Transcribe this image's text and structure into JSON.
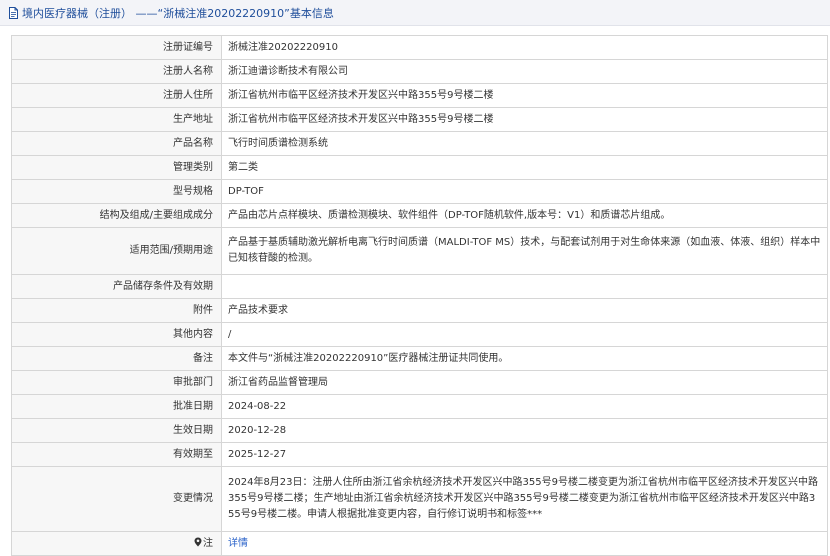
{
  "header": {
    "icon": "document-icon",
    "title": "境内医疗器械（注册） ——“浙械注准20202220910”基本信息"
  },
  "rows": [
    {
      "label": "注册证编号",
      "value": "浙械注准20202220910"
    },
    {
      "label": "注册人名称",
      "value": "浙江迪谱诊断技术有限公司"
    },
    {
      "label": "注册人住所",
      "value": "浙江省杭州市临平区经济技术开发区兴中路355号9号楼二楼"
    },
    {
      "label": "生产地址",
      "value": "浙江省杭州市临平区经济技术开发区兴中路355号9号楼二楼"
    },
    {
      "label": "产品名称",
      "value": "飞行时间质谱检测系统"
    },
    {
      "label": "管理类别",
      "value": "第二类"
    },
    {
      "label": "型号规格",
      "value": "DP-TOF"
    },
    {
      "label": "结构及组成/主要组成成分",
      "value": "产品由芯片点样模块、质谱检测模块、软件组件（DP-TOF随机软件,版本号：V1）和质谱芯片组成。"
    },
    {
      "label": "适用范围/预期用途",
      "value": "产品基于基质辅助激光解析电离飞行时间质谱（MALDI-TOF MS）技术，与配套试剂用于对生命体来源（如血液、体液、组织）样本中已知核苷酸的检测。"
    },
    {
      "label": "产品储存条件及有效期",
      "value": ""
    },
    {
      "label": "附件",
      "value": "产品技术要求"
    },
    {
      "label": "其他内容",
      "value": "/"
    },
    {
      "label": "备注",
      "value": "本文件与“浙械注准20202220910”医疗器械注册证共同使用。"
    },
    {
      "label": "审批部门",
      "value": "浙江省药品监督管理局"
    },
    {
      "label": "批准日期",
      "value": "2024-08-22"
    },
    {
      "label": "生效日期",
      "value": "2020-12-28"
    },
    {
      "label": "有效期至",
      "value": "2025-12-27"
    },
    {
      "label": "变更情况",
      "value": "2024年8月23日：注册人住所由浙江省余杭经济技术开发区兴中路355号9号楼二楼变更为浙江省杭州市临平区经济技术开发区兴中路355号9号楼二楼；生产地址由浙江省余杭经济技术开发区兴中路355号9号楼二楼变更为浙江省杭州市临平区经济技术开发区兴中路355号9号楼二楼。申请人根据批准变更内容，自行修订说明书和标签***"
    }
  ],
  "note_row": {
    "icon": "location-pin-icon",
    "label": "注",
    "link_text": "详情"
  }
}
